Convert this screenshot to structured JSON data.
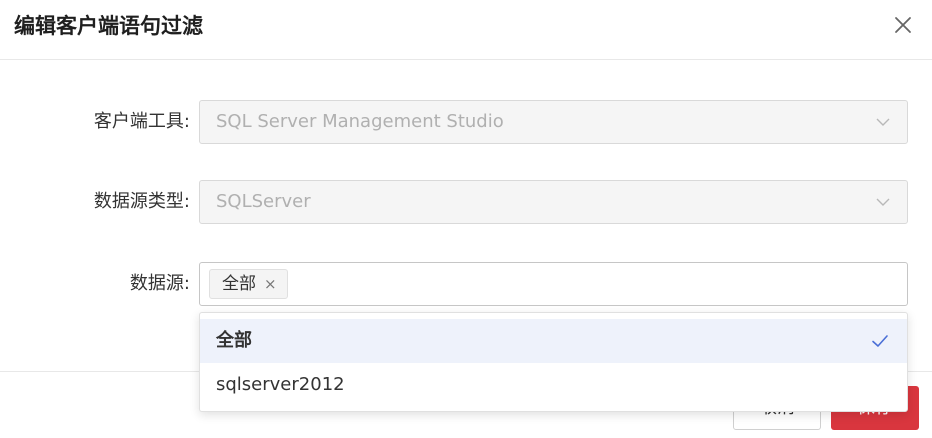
{
  "dialog": {
    "title": "编辑客户端语句过滤"
  },
  "form": {
    "client_tool": {
      "label": "客户端工具:",
      "value": "SQL Server Management Studio"
    },
    "datasource_type": {
      "label": "数据源类型:",
      "value": "SQLServer"
    },
    "datasource": {
      "label": "数据源:",
      "tags": [
        "全部"
      ],
      "tag_remove_glyph": "×"
    }
  },
  "dropdown": {
    "options": [
      {
        "label": "全部",
        "selected": true
      },
      {
        "label": "sqlserver2012",
        "selected": false
      }
    ]
  },
  "footer": {
    "cancel_label": "取消",
    "save_label": "保存"
  },
  "colors": {
    "primary": "#d9363e",
    "selected_bg": "#eef2fb",
    "check": "#4a6fd6"
  },
  "icons": {
    "close": "close-icon",
    "chevron": "chevron-down-icon",
    "check": "check-icon"
  }
}
